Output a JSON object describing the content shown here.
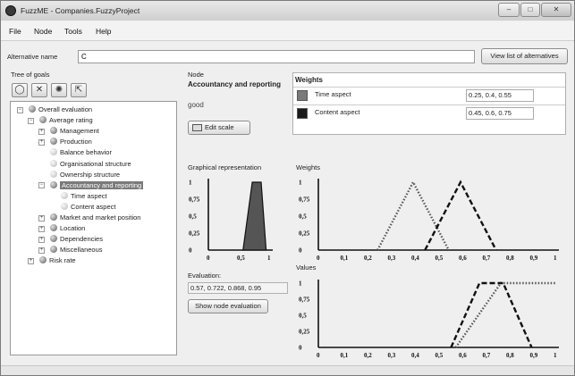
{
  "window": {
    "title": "FuzzME - Companies.FuzzyProject",
    "controls": [
      "minimize-icon",
      "maximize-icon",
      "close-icon"
    ]
  },
  "menu": [
    "File",
    "Node",
    "Tools",
    "Help"
  ],
  "alternative": {
    "label": "Alternative name",
    "value": "C",
    "list_button": "View list of alternatives"
  },
  "tree": {
    "label": "Tree of goals",
    "toolbar_icons": [
      "add-node-icon",
      "delete-node-icon",
      "node-properties-icon",
      "move-node-icon"
    ],
    "nodes": [
      {
        "label": "Overall evaluation",
        "depth": 0,
        "expander": "minus",
        "icon": "chart-icon"
      },
      {
        "label": "Average rating",
        "depth": 1,
        "expander": "minus",
        "icon": "node-icon"
      },
      {
        "label": "Management",
        "depth": 2,
        "expander": "plus",
        "icon": "node-icon"
      },
      {
        "label": "Production",
        "depth": 2,
        "expander": "plus",
        "icon": "node-icon"
      },
      {
        "label": "Balance behavior",
        "depth": 2,
        "expander": "",
        "icon": "leaf-icon"
      },
      {
        "label": "Organisational structure",
        "depth": 2,
        "expander": "",
        "icon": "leaf-icon"
      },
      {
        "label": "Ownership structure",
        "depth": 2,
        "expander": "",
        "icon": "leaf-icon"
      },
      {
        "label": "Accountancy and reporting",
        "depth": 2,
        "expander": "minus",
        "icon": "node-icon",
        "selected": true
      },
      {
        "label": "Time aspect",
        "depth": 3,
        "expander": "",
        "icon": "leaf-icon"
      },
      {
        "label": "Content aspect",
        "depth": 3,
        "expander": "",
        "icon": "leaf-icon"
      },
      {
        "label": "Market and market position",
        "depth": 2,
        "expander": "plus",
        "icon": "node-icon"
      },
      {
        "label": "Location",
        "depth": 2,
        "expander": "plus",
        "icon": "node-icon"
      },
      {
        "label": "Dependencies",
        "depth": 2,
        "expander": "plus",
        "icon": "node-icon"
      },
      {
        "label": "Miscellaneous",
        "depth": 2,
        "expander": "plus",
        "icon": "node-icon"
      },
      {
        "label": "Risk rate",
        "depth": 1,
        "expander": "plus",
        "icon": "person-icon"
      }
    ]
  },
  "node": {
    "label": "Node",
    "name": "Accountancy and reporting",
    "term": "good",
    "edit_scale": "Edit scale",
    "graph_label": "Graphical representation",
    "evaluation_label": "Evaluation:",
    "evaluation_value": "0.57, 0.722, 0.868, 0.95",
    "show_button": "Show node evaluation"
  },
  "weights": {
    "title": "Weights",
    "rows": [
      {
        "name": "Time aspect",
        "value": "0.25, 0.4, 0.55",
        "color": "#7a7a7a"
      },
      {
        "name": "Content aspect",
        "value": "0.45, 0.6, 0.75",
        "color": "#1a1a1a"
      }
    ]
  },
  "charts": {
    "weights_label": "Weights",
    "values_label": "Values"
  },
  "chart_data": [
    {
      "type": "area",
      "x_ticks": [
        "0",
        "0,5",
        "1"
      ],
      "y_ticks": [
        "0",
        "0,25",
        "0,5",
        "0,75",
        "1"
      ],
      "xlim": [
        0,
        1
      ],
      "ylim": [
        0,
        1
      ],
      "series": [
        {
          "points": [
            [
              0.57,
              0
            ],
            [
              0.722,
              1
            ],
            [
              0.868,
              1
            ],
            [
              0.95,
              0
            ]
          ],
          "color": "#555555"
        }
      ]
    },
    {
      "type": "line",
      "x_ticks": [
        "0",
        "0,1",
        "0,2",
        "0,3",
        "0,4",
        "0,5",
        "0,6",
        "0,7",
        "0,8",
        "0,9",
        "1"
      ],
      "y_ticks": [
        "0",
        "0,25",
        "0,5",
        "0,75",
        "1"
      ],
      "xlim": [
        0,
        1
      ],
      "ylim": [
        0,
        1
      ],
      "series": [
        {
          "name": "Time aspect",
          "points": [
            [
              0.25,
              0
            ],
            [
              0.4,
              1
            ],
            [
              0.55,
              0
            ]
          ],
          "style": "dotted",
          "color": "#555555"
        },
        {
          "name": "Content aspect",
          "points": [
            [
              0.45,
              0
            ],
            [
              0.6,
              1
            ],
            [
              0.75,
              0
            ]
          ],
          "style": "dashed",
          "color": "#111111"
        }
      ]
    },
    {
      "type": "line",
      "x_ticks": [
        "0",
        "0,1",
        "0,2",
        "0,3",
        "0,4",
        "0,5",
        "0,6",
        "0,7",
        "0,8",
        "0,9",
        "1"
      ],
      "y_ticks": [
        "0",
        "0,25",
        "0,5",
        "0,75",
        "1"
      ],
      "xlim": [
        0,
        1
      ],
      "ylim": [
        0,
        1
      ],
      "series": [
        {
          "name": "Time aspect",
          "points": [
            [
              0.58,
              0
            ],
            [
              0.77,
              1
            ],
            [
              1,
              1
            ]
          ],
          "style": "dotted",
          "color": "#555555"
        },
        {
          "name": "Content aspect",
          "points": [
            [
              0.56,
              0
            ],
            [
              0.68,
              1
            ],
            [
              0.78,
              1
            ],
            [
              0.9,
              0
            ]
          ],
          "style": "dashed",
          "color": "#111111"
        }
      ]
    }
  ]
}
